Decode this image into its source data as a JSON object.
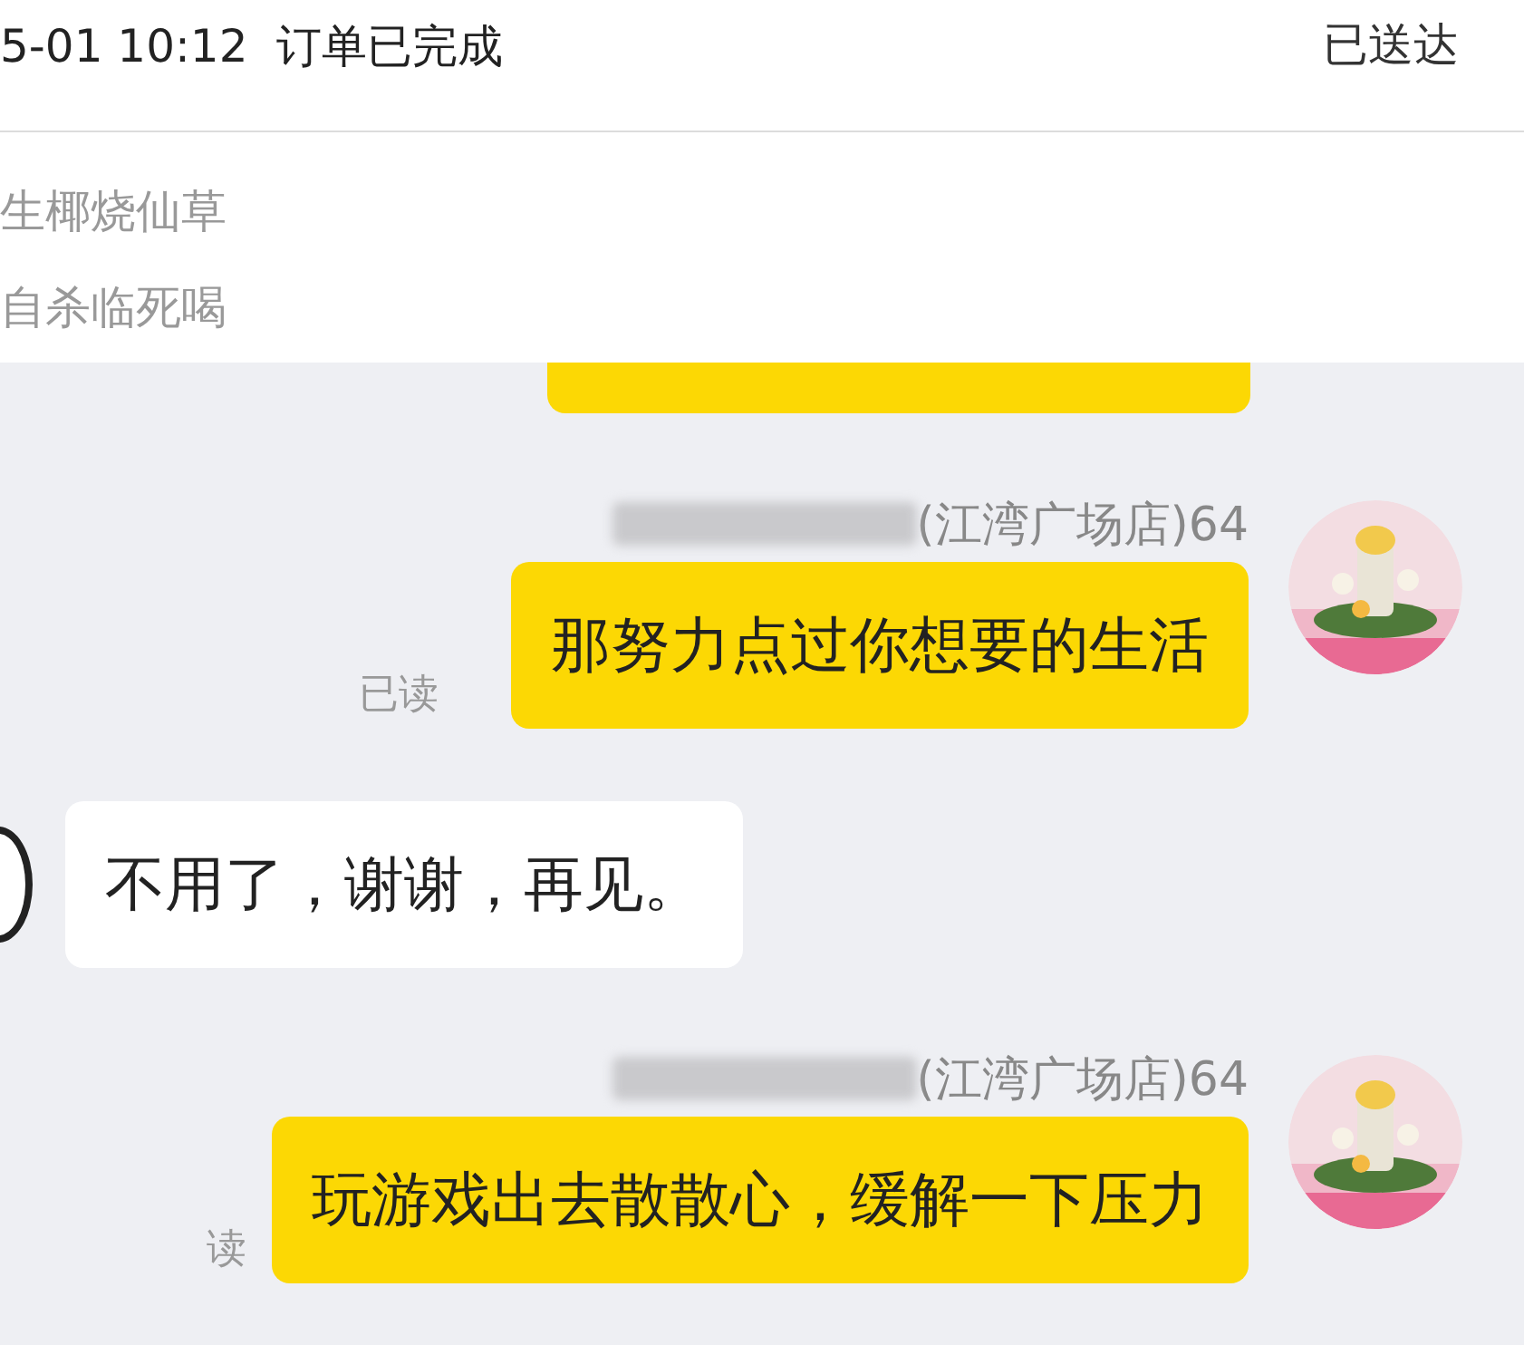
{
  "header": {
    "time": "5-01 10:12",
    "status": "订单已完成",
    "delivery": "已送达"
  },
  "order_items": [
    "生椰烧仙草",
    "自杀临死喝"
  ],
  "messages": [
    {
      "kind": "partial"
    },
    {
      "kind": "outgoing",
      "sender_suffix": "(江湾广场店)64",
      "text": "那努力点过你想要的生活",
      "read_label": "已读"
    },
    {
      "kind": "incoming",
      "text": "不用了，谢谢，再见。"
    },
    {
      "kind": "outgoing",
      "sender_suffix": "(江湾广场店)64",
      "text": "玩游戏出去散散心，缓解一下压力",
      "read_label": "读"
    }
  ]
}
